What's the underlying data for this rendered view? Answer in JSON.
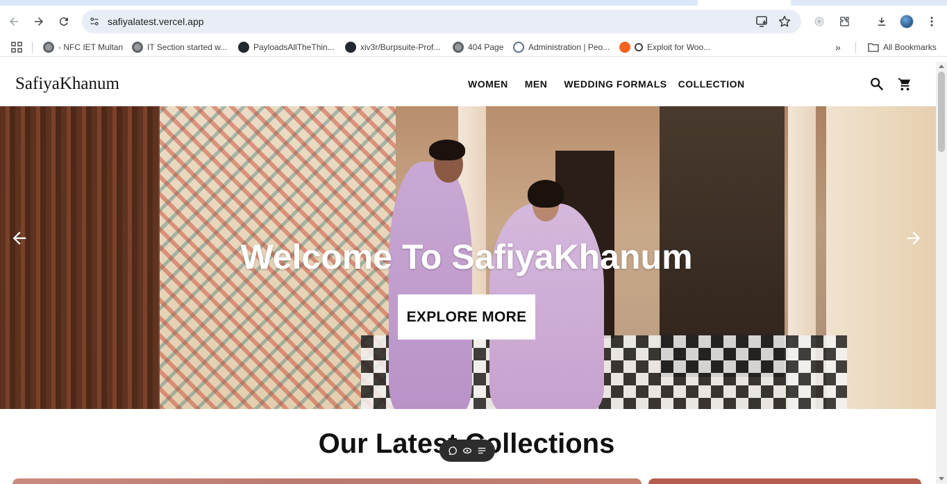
{
  "browser": {
    "url": "safiyalatest.vercel.app",
    "bookmarks": [
      {
        "label": "- NFC IET Multan",
        "icon": "globe-icon"
      },
      {
        "label": "IT Section started w...",
        "icon": "globe-icon"
      },
      {
        "label": "PayloadsAllTheThin...",
        "icon": "github-icon"
      },
      {
        "label": "xiv3r/Burpsuite-Prof...",
        "icon": "github-icon"
      },
      {
        "label": "404 Page",
        "icon": "globe-icon"
      },
      {
        "label": "Administration | Peo...",
        "icon": "admin-icon"
      },
      {
        "label": "Exploit for Woo...",
        "icon": "skull-icon"
      }
    ],
    "all_bookmarks_label": "All Bookmarks",
    "overflow_label": "»"
  },
  "site": {
    "logo": "SafiyaKhanum",
    "nav": [
      "WOMEN",
      "MEN",
      "WEDDING FORMALS",
      "COLLECTION"
    ],
    "hero": {
      "title": "Welcome To SafiyaKhanum",
      "button": "EXPLORE MORE"
    },
    "section_title": "Our Latest Collections"
  },
  "colors": {
    "chrome_bg": "#ffffff",
    "omnibox_bg": "#e9eef6",
    "tab_active": "#dbe6fb",
    "text_dark": "#111111",
    "hero_text": "#ffffff"
  }
}
